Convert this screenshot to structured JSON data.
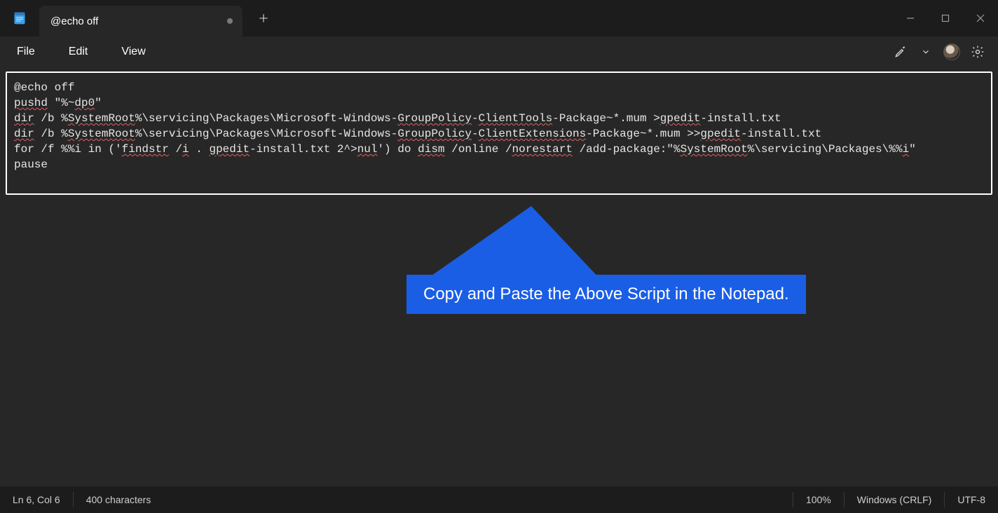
{
  "tab": {
    "title": "@echo off"
  },
  "menu": {
    "file": "File",
    "edit": "Edit",
    "view": "View"
  },
  "editor": {
    "lines": [
      "@echo off",
      "pushd \"%~dp0\"",
      "dir /b %SystemRoot%\\servicing\\Packages\\Microsoft-Windows-GroupPolicy-ClientTools-Package~*.mum >gpedit-install.txt",
      "dir /b %SystemRoot%\\servicing\\Packages\\Microsoft-Windows-GroupPolicy-ClientExtensions-Package~*.mum >>gpedit-install.txt",
      "for /f %%i in ('findstr /i . gpedit-install.txt 2^>nul') do dism /online /norestart /add-package:\"%SystemRoot%\\servicing\\Packages\\%%i\"",
      "pause"
    ],
    "w1a": "@echo off",
    "w2a": "pushd",
    "w2b": " \"%~",
    "w2c": "dp0",
    "w2d": "\"",
    "w3a": "dir",
    "w3b": " /b %",
    "w3c": "SystemRoot",
    "w3d": "%\\servicing\\Packages\\Microsoft-Windows-",
    "w3e": "GroupPolicy",
    "w3f": "-",
    "w3g": "ClientTools",
    "w3h": "-Package~*.mum >",
    "w3i": "gpedit",
    "w3j": "-install.txt",
    "w4a": "dir",
    "w4b": " /b %",
    "w4c": "SystemRoot",
    "w4d": "%\\servicing\\Packages\\Microsoft-Windows-",
    "w4e": "GroupPolicy",
    "w4f": "-",
    "w4g": "ClientExtensions",
    "w4h": "-Package~*.mum >>",
    "w4i": "gpedit",
    "w4j": "-install.txt",
    "w5a": "for /f %%i in ('",
    "w5b": "findstr",
    "w5c": " /",
    "w5d": "i",
    "w5e": " . ",
    "w5f": "gpedit",
    "w5g": "-install.txt 2^>",
    "w5h": "nul",
    "w5i": "') do ",
    "w5j": "dism",
    "w5k": " /online /",
    "w5l": "norestart",
    "w5m": " /add-package:\"%",
    "w5n": "SystemRoot",
    "w5o": "%\\servicing\\Packages\\%%",
    "w5p": "i",
    "w5q": "\"",
    "w6a": "pause"
  },
  "callout": {
    "text": "Copy and Paste the Above Script in the Notepad."
  },
  "status": {
    "cursor": "Ln 6, Col 6",
    "chars": "400 characters",
    "zoom": "100%",
    "eol": "Windows (CRLF)",
    "encoding": "UTF-8"
  }
}
